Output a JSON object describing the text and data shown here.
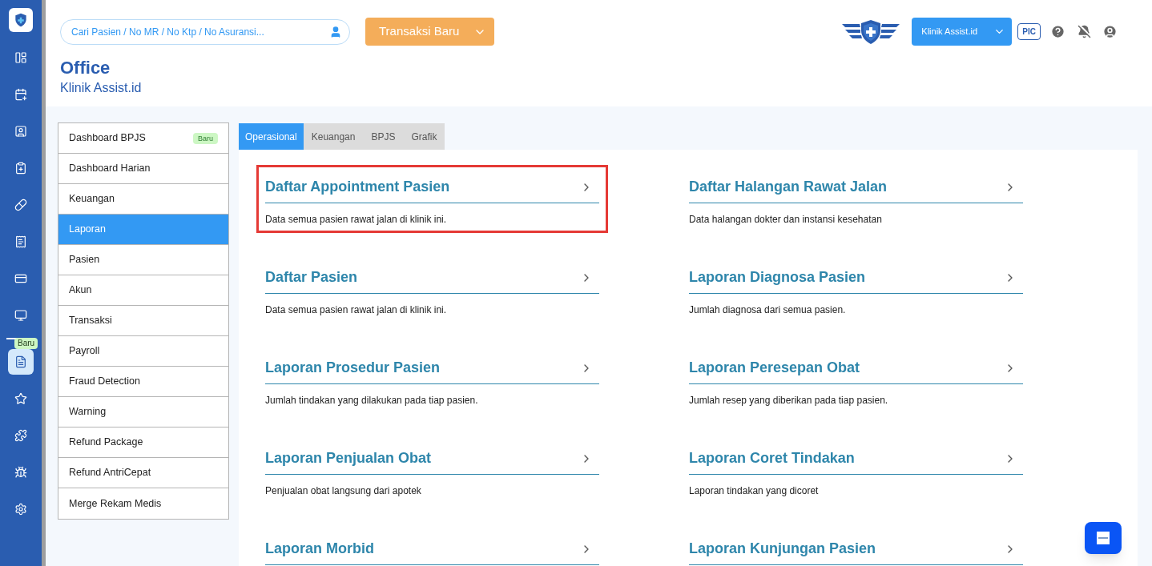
{
  "rail": {
    "items": [
      {
        "kind": "link",
        "selected": false
      },
      {
        "kind": "link",
        "selected": false
      },
      {
        "kind": "link",
        "selected": false
      },
      {
        "kind": "link",
        "selected": false
      },
      {
        "kind": "link",
        "selected": false
      },
      {
        "kind": "link",
        "selected": false
      },
      {
        "kind": "link",
        "selected": false
      },
      {
        "kind": "link",
        "selected": false
      },
      {
        "kind": "divider"
      },
      {
        "kind": "link",
        "selected": true,
        "badge": "Baru"
      },
      {
        "kind": "link",
        "selected": false
      },
      {
        "kind": "link",
        "selected": false
      },
      {
        "kind": "link",
        "selected": false
      },
      {
        "kind": "link",
        "selected": false
      }
    ]
  },
  "header": {
    "search": {
      "placeholder": "Cari Pasien / No MR / No Ktp / No Asuransi..."
    },
    "new_transaction": "Transaksi Baru",
    "clinic_select": "Klinik Assist.id",
    "role": "PIC"
  },
  "page": {
    "title": "Office",
    "subtitle": "Klinik Assist.id"
  },
  "menu": [
    {
      "label": "Dashboard BPJS",
      "badge": "Baru",
      "selected": false
    },
    {
      "label": "Dashboard Harian",
      "selected": false
    },
    {
      "label": "Keuangan",
      "selected": false
    },
    {
      "label": "Laporan",
      "selected": true
    },
    {
      "label": "Pasien",
      "selected": false
    },
    {
      "label": "Akun",
      "selected": false
    },
    {
      "label": "Transaksi",
      "selected": false
    },
    {
      "label": "Payroll",
      "selected": false
    },
    {
      "label": "Fraud Detection",
      "selected": false
    },
    {
      "label": "Warning",
      "selected": false
    },
    {
      "label": "Refund Package",
      "selected": false
    },
    {
      "label": "Refund AntriCepat",
      "selected": false
    },
    {
      "label": "Merge Rekam Medis",
      "selected": false
    }
  ],
  "tabs": [
    {
      "label": "Operasional",
      "selected": true
    },
    {
      "label": "Keuangan",
      "selected": false
    },
    {
      "label": "BPJS",
      "selected": false
    },
    {
      "label": "Grafik",
      "selected": false
    }
  ],
  "reports": [
    {
      "title": "Daftar Appointment Pasien",
      "description": "Data semua pasien rawat jalan di klinik ini.",
      "highlighted": true
    },
    {
      "title": "Daftar Halangan Rawat Jalan",
      "description": "Data halangan dokter dan instansi kesehatan",
      "highlighted": false
    },
    {
      "title": "Daftar Pasien",
      "description": "Data semua pasien rawat jalan di klinik ini.",
      "highlighted": false
    },
    {
      "title": "Laporan Diagnosa Pasien",
      "description": "Jumlah diagnosa dari semua pasien.",
      "highlighted": false
    },
    {
      "title": "Laporan Prosedur Pasien",
      "description": "Jumlah tindakan yang dilakukan pada tiap pasien.",
      "highlighted": false
    },
    {
      "title": "Laporan Peresepan Obat",
      "description": "Jumlah resep yang diberikan pada tiap pasien.",
      "highlighted": false
    },
    {
      "title": "Laporan Penjualan Obat",
      "description": "Penjualan obat langsung dari apotek",
      "highlighted": false
    },
    {
      "title": "Laporan Coret Tindakan",
      "description": "Laporan tindakan yang dicoret",
      "highlighted": false
    },
    {
      "title": "Laporan Morbid",
      "highlighted": false
    },
    {
      "title": "Laporan Kunjungan Pasien",
      "highlighted": false
    }
  ]
}
